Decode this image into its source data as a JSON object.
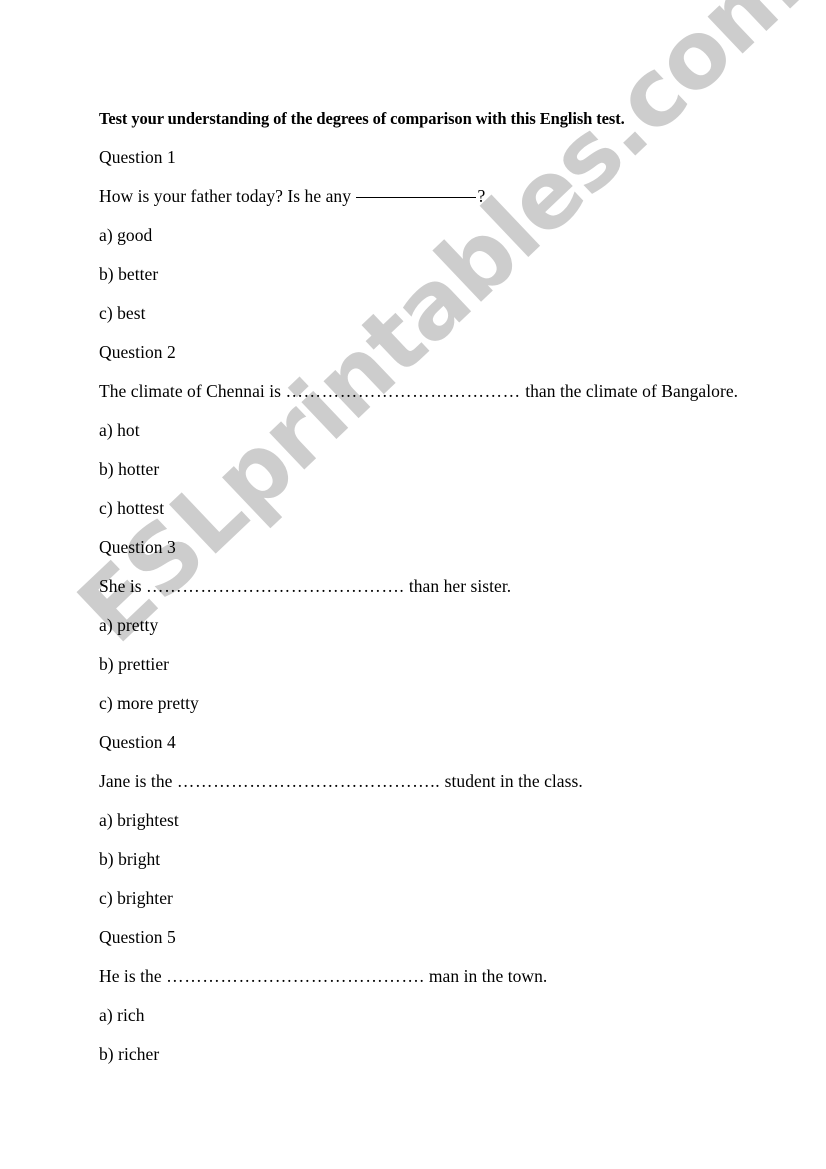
{
  "document": {
    "title": "Test your understanding of the degrees of comparison with this English test.",
    "watermark": "ESLprintables.com",
    "watermark_color": "#cdcdcd",
    "background_color": "#ffffff",
    "text_color": "#000000"
  },
  "lines": {
    "q1_label": "Question 1",
    "q1_prompt_before": "How is your father today? Is he any ",
    "q1_prompt_after": "?",
    "q1_a": "a) good",
    "q1_b": "b) better",
    "q1_c": "c) best",
    "q2_label": "Question 2",
    "q2_prompt_before": "The climate of Chennai is ",
    "q2_prompt_dots": "…………………………………",
    "q2_prompt_after": " than the climate of Bangalore.",
    "q2_a": "a) hot",
    "q2_b": "b) hotter",
    "q2_c": "c) hottest",
    "q3_label": "Question 3",
    "q3_prompt_before": "She is ",
    "q3_prompt_dots": "…………………………………….",
    "q3_prompt_after": " than her sister.",
    "q3_a": "a) pretty",
    "q3_b": "b) prettier",
    "q3_c": "c) more pretty",
    "q4_label": "Question 4",
    "q4_prompt_before": "Jane is the ",
    "q4_prompt_dots": "……………………………………..",
    "q4_prompt_after": " student in the class.",
    "q4_a": "a) brightest",
    "q4_b": "b) bright",
    "q4_c": "c) brighter",
    "q5_label": "Question 5",
    "q5_prompt_before": "He is the ",
    "q5_prompt_dots": "…………………………………….",
    "q5_prompt_after": " man in the town.",
    "q5_a": "a) rich",
    "q5_b": "b) richer"
  }
}
